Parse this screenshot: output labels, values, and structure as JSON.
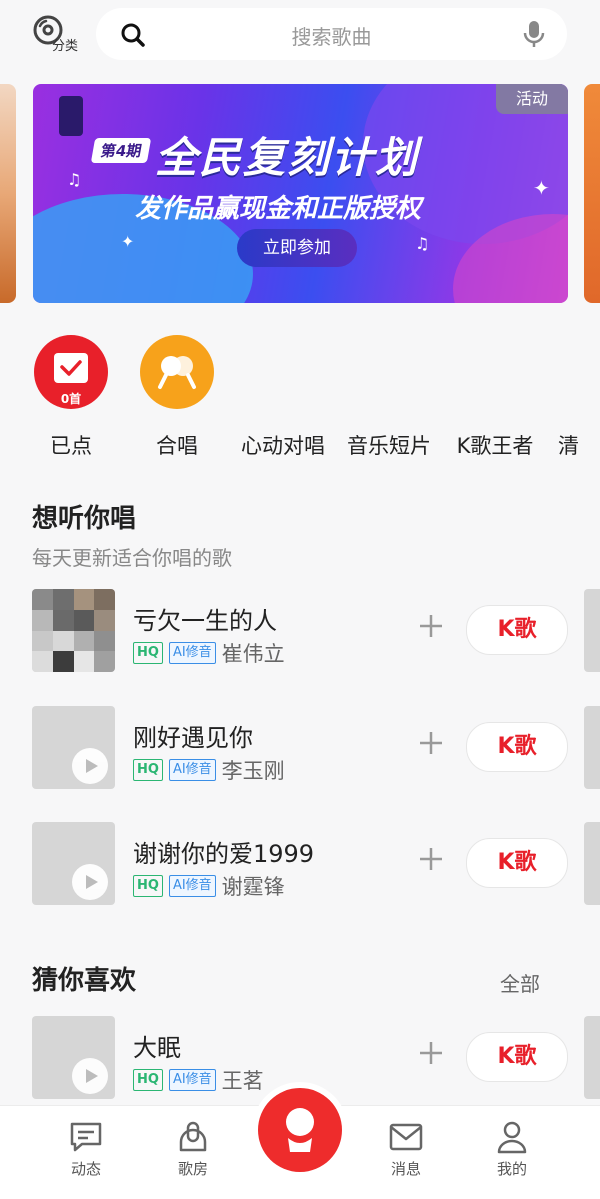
{
  "header": {
    "category_label": "分类",
    "search_placeholder": "搜索歌曲"
  },
  "banner": {
    "tag": "活动",
    "issue": "第4期",
    "title": "全民复刻计划",
    "subtitle": "发作品赢现金和正版授权",
    "button": "立即参加"
  },
  "quick_entries": [
    {
      "label": "已点",
      "badge": "0首",
      "color": "#e8202a"
    },
    {
      "label": "合唱",
      "color": "#f7a21b"
    },
    {
      "label": "心动对唱"
    },
    {
      "label": "音乐短片"
    },
    {
      "label": "K歌王者"
    },
    {
      "label": "清"
    }
  ],
  "section_want": {
    "title": "想听你唱",
    "subtitle": "每天更新适合你唱的歌",
    "songs": [
      {
        "name": "亏欠一生的人",
        "hq": "HQ",
        "ai": "AI修音",
        "singer": "崔伟立",
        "action": "K歌"
      },
      {
        "name": "刚好遇见你",
        "hq": "HQ",
        "ai": "AI修音",
        "singer": "李玉刚",
        "action": "K歌"
      },
      {
        "name": "谢谢你的爱1999",
        "hq": "HQ",
        "ai": "AI修音",
        "singer": "谢霆锋",
        "action": "K歌"
      }
    ]
  },
  "section_guess": {
    "title": "猜你喜欢",
    "more": "全部",
    "songs": [
      {
        "name": "大眠",
        "hq": "HQ",
        "ai": "AI修音",
        "singer": "王茗",
        "action": "K歌"
      }
    ]
  },
  "bottom_nav": [
    {
      "label": "动态",
      "icon": "chat-icon"
    },
    {
      "label": "歌房",
      "icon": "mic-room-icon"
    },
    {
      "label": "",
      "icon": "sing-icon"
    },
    {
      "label": "消息",
      "icon": "mail-icon"
    },
    {
      "label": "我的",
      "icon": "user-icon"
    }
  ],
  "colors": {
    "accent_red": "#e8202a",
    "hq_green": "#2bb673",
    "ai_blue": "#3a8ee6",
    "orange": "#f7a21b"
  }
}
